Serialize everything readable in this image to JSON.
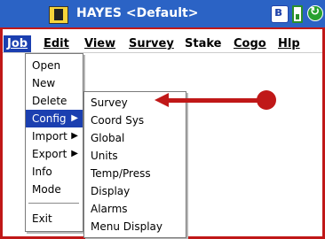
{
  "titlebar": {
    "title": "HAYES <Default>"
  },
  "menubar": {
    "items": [
      {
        "label": "Job"
      },
      {
        "label": "Edit"
      },
      {
        "label": "View"
      },
      {
        "label": "Survey"
      },
      {
        "label": "Stake"
      },
      {
        "label": "Cogo"
      },
      {
        "label": "Hlp"
      }
    ]
  },
  "job_menu": {
    "items": [
      {
        "label": "Open"
      },
      {
        "label": "New"
      },
      {
        "label": "Delete"
      },
      {
        "label": "Config"
      },
      {
        "label": "Import"
      },
      {
        "label": "Export"
      },
      {
        "label": "Info"
      },
      {
        "label": "Mode"
      },
      {
        "label": "Exit"
      }
    ],
    "highlighted": "Config",
    "submenu_arrow": "▶"
  },
  "config_menu": {
    "items": [
      {
        "label": "Survey"
      },
      {
        "label": "Coord Sys"
      },
      {
        "label": "Global"
      },
      {
        "label": "Units"
      },
      {
        "label": "Temp/Press"
      },
      {
        "label": "Display"
      },
      {
        "label": "Alarms"
      },
      {
        "label": "Menu Display"
      }
    ]
  },
  "annotation": {
    "color": "#c01818"
  }
}
